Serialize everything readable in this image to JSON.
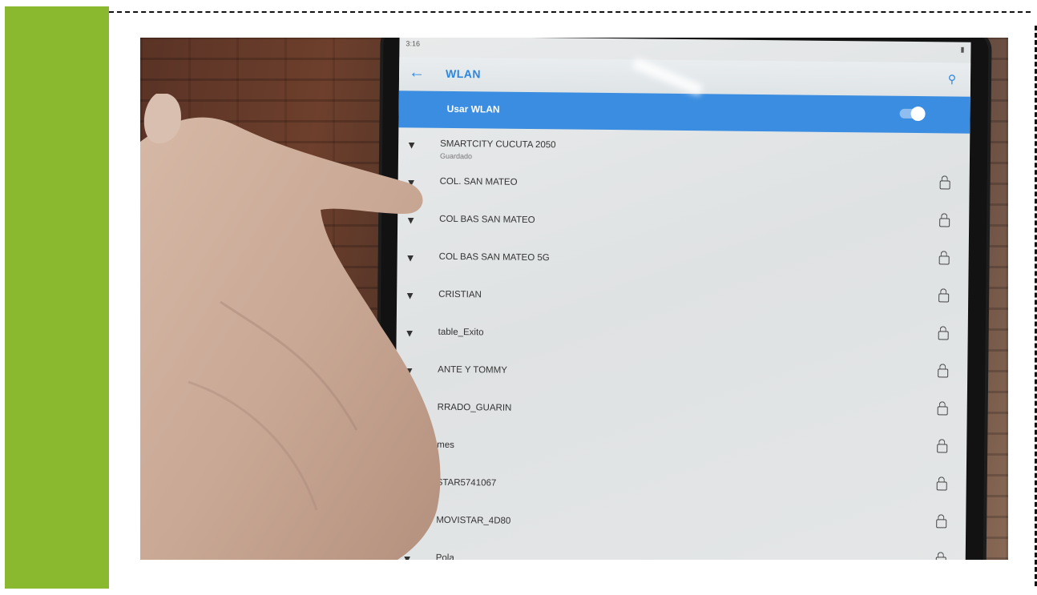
{
  "screen": {
    "status_time": "3:16",
    "app_title": "WLAN",
    "toggle_label": "Usar WLAN",
    "networks": [
      {
        "name": "SMARTCITY CUCUTA 2050",
        "sub": "Guardado",
        "locked": false
      },
      {
        "name": "COL. SAN MATEO",
        "locked": true
      },
      {
        "name": "COL BAS SAN MATEO",
        "locked": true
      },
      {
        "name": "COL BAS SAN MATEO 5G",
        "locked": true
      },
      {
        "name": "CRISTIAN",
        "locked": true
      },
      {
        "name": "table_Exito",
        "locked": true
      },
      {
        "name": "ANTE Y TOMMY",
        "locked": true
      },
      {
        "name": "RRADO_GUARIN",
        "locked": true
      },
      {
        "name": "mes",
        "locked": true
      },
      {
        "name": "STAR5741067",
        "locked": true
      },
      {
        "name": "MOVISTAR_4D80",
        "locked": true
      },
      {
        "name": "Pola",
        "locked": true
      }
    ]
  },
  "colors": {
    "side_bar": "#8ab82f",
    "accent_blue": "#3a8de0"
  }
}
